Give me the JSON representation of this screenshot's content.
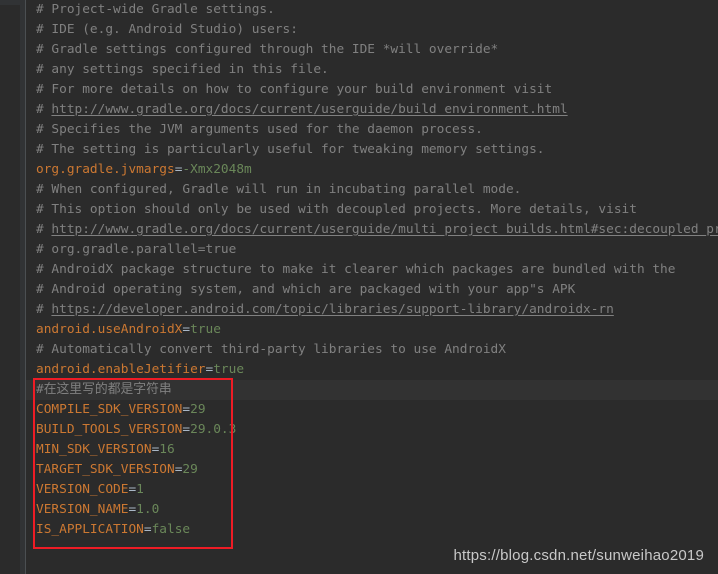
{
  "editor": {
    "theme": "darcula",
    "background": "#2b2b2b",
    "gutter_background": "#313335",
    "current_line_background": "#323232",
    "comment_color": "#808080",
    "key_color": "#cc7832",
    "value_color": "#6a8759",
    "operator_color": "#a9b7c6",
    "annotation_color": "#ee1c25"
  },
  "lines": [
    {
      "id": "l1",
      "type": "comment",
      "text": "# Project-wide Gradle settings."
    },
    {
      "id": "l2",
      "type": "comment",
      "text": "# IDE (e.g. Android Studio) users:"
    },
    {
      "id": "l3",
      "type": "comment",
      "text": "# Gradle settings configured through the IDE *will override*"
    },
    {
      "id": "l4",
      "type": "comment",
      "text": "# any settings specified in this file."
    },
    {
      "id": "l5",
      "type": "comment",
      "text": "# For more details on how to configure your build environment visit"
    },
    {
      "id": "l6",
      "type": "comment-link",
      "prefix": "# ",
      "link": "http://www.gradle.org/docs/current/userguide/build_environment.html"
    },
    {
      "id": "l7",
      "type": "comment",
      "text": "# Specifies the JVM arguments used for the daemon process."
    },
    {
      "id": "l8",
      "type": "comment",
      "text": "# The setting is particularly useful for tweaking memory settings."
    },
    {
      "id": "l9",
      "type": "property",
      "key": "org.gradle.jvmargs",
      "eq": "=",
      "value": "-Xmx2048m"
    },
    {
      "id": "l10",
      "type": "comment",
      "text": "# When configured, Gradle will run in incubating parallel mode."
    },
    {
      "id": "l11",
      "type": "comment",
      "text": "# This option should only be used with decoupled projects. More details, visit"
    },
    {
      "id": "l12",
      "type": "comment-link",
      "prefix": "# ",
      "link": "http://www.gradle.org/docs/current/userguide/multi_project_builds.html#sec:decoupled_projects"
    },
    {
      "id": "l13",
      "type": "comment",
      "text": "# org.gradle.parallel=true"
    },
    {
      "id": "l14",
      "type": "comment",
      "text": "# AndroidX package structure to make it clearer which packages are bundled with the"
    },
    {
      "id": "l15",
      "type": "comment",
      "text": "# Android operating system, and which are packaged with your app\"s APK"
    },
    {
      "id": "l16",
      "type": "comment-link",
      "prefix": "# ",
      "link": "https://developer.android.com/topic/libraries/support-library/androidx-rn"
    },
    {
      "id": "l17",
      "type": "property",
      "key": "android.useAndroidX",
      "eq": "=",
      "value": "true"
    },
    {
      "id": "l18",
      "type": "comment",
      "text": "# Automatically convert third-party libraries to use AndroidX"
    },
    {
      "id": "l19",
      "type": "property",
      "key": "android.enableJetifier",
      "eq": "=",
      "value": "true"
    },
    {
      "id": "l20",
      "type": "comment",
      "text": "#在这里写的都是字符串",
      "highlight": true
    },
    {
      "id": "l21",
      "type": "property",
      "key": "COMPILE_SDK_VERSION",
      "eq": "=",
      "value": "29"
    },
    {
      "id": "l22",
      "type": "property",
      "key": "BUILD_TOOLS_VERSION",
      "eq": "=",
      "value": "29.0.3"
    },
    {
      "id": "l23",
      "type": "property",
      "key": "MIN_SDK_VERSION",
      "eq": "=",
      "value": "16"
    },
    {
      "id": "l24",
      "type": "property",
      "key": "TARGET_SDK_VERSION",
      "eq": "=",
      "value": "29"
    },
    {
      "id": "l25",
      "type": "property",
      "key": "VERSION_CODE",
      "eq": "=",
      "value": "1"
    },
    {
      "id": "l26",
      "type": "property",
      "key": "VERSION_NAME",
      "eq": "=",
      "value": "1.0"
    },
    {
      "id": "l27",
      "type": "property",
      "key": "IS_APPLICATION",
      "eq": "=",
      "value": "false"
    }
  ],
  "annotation": {
    "name": "red-highlight-rectangle",
    "color": "#ee1c25"
  },
  "watermark": {
    "text": "https://blog.csdn.net/sunweihao2019"
  }
}
